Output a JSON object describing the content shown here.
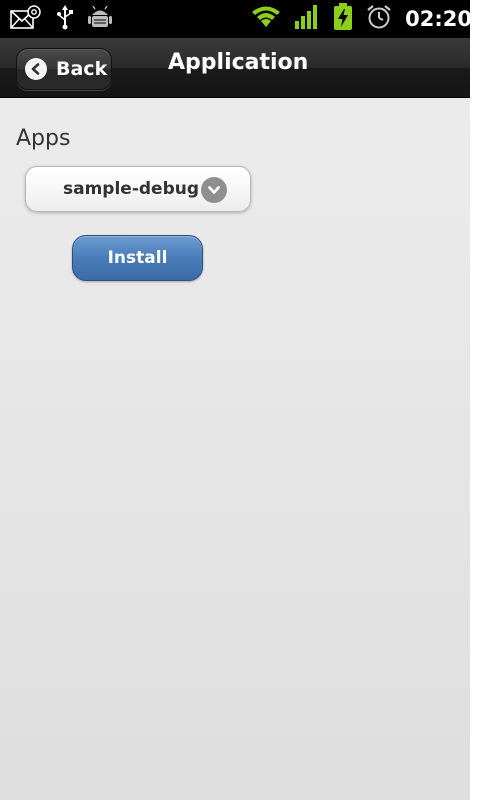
{
  "status_bar": {
    "time": "02:20",
    "left_icons": [
      "email-icon",
      "usb-icon",
      "android-debug-icon"
    ],
    "right_icons": [
      "wifi-icon",
      "signal-icon",
      "battery-charging-icon",
      "alarm-icon"
    ],
    "accent_green": "#8ccf1b"
  },
  "header": {
    "back_label": "Back",
    "title": "Application"
  },
  "main": {
    "section_label": "Apps",
    "select": {
      "value": "sample-debug"
    },
    "install_label": "Install",
    "install_color": "#4a7cb8"
  }
}
